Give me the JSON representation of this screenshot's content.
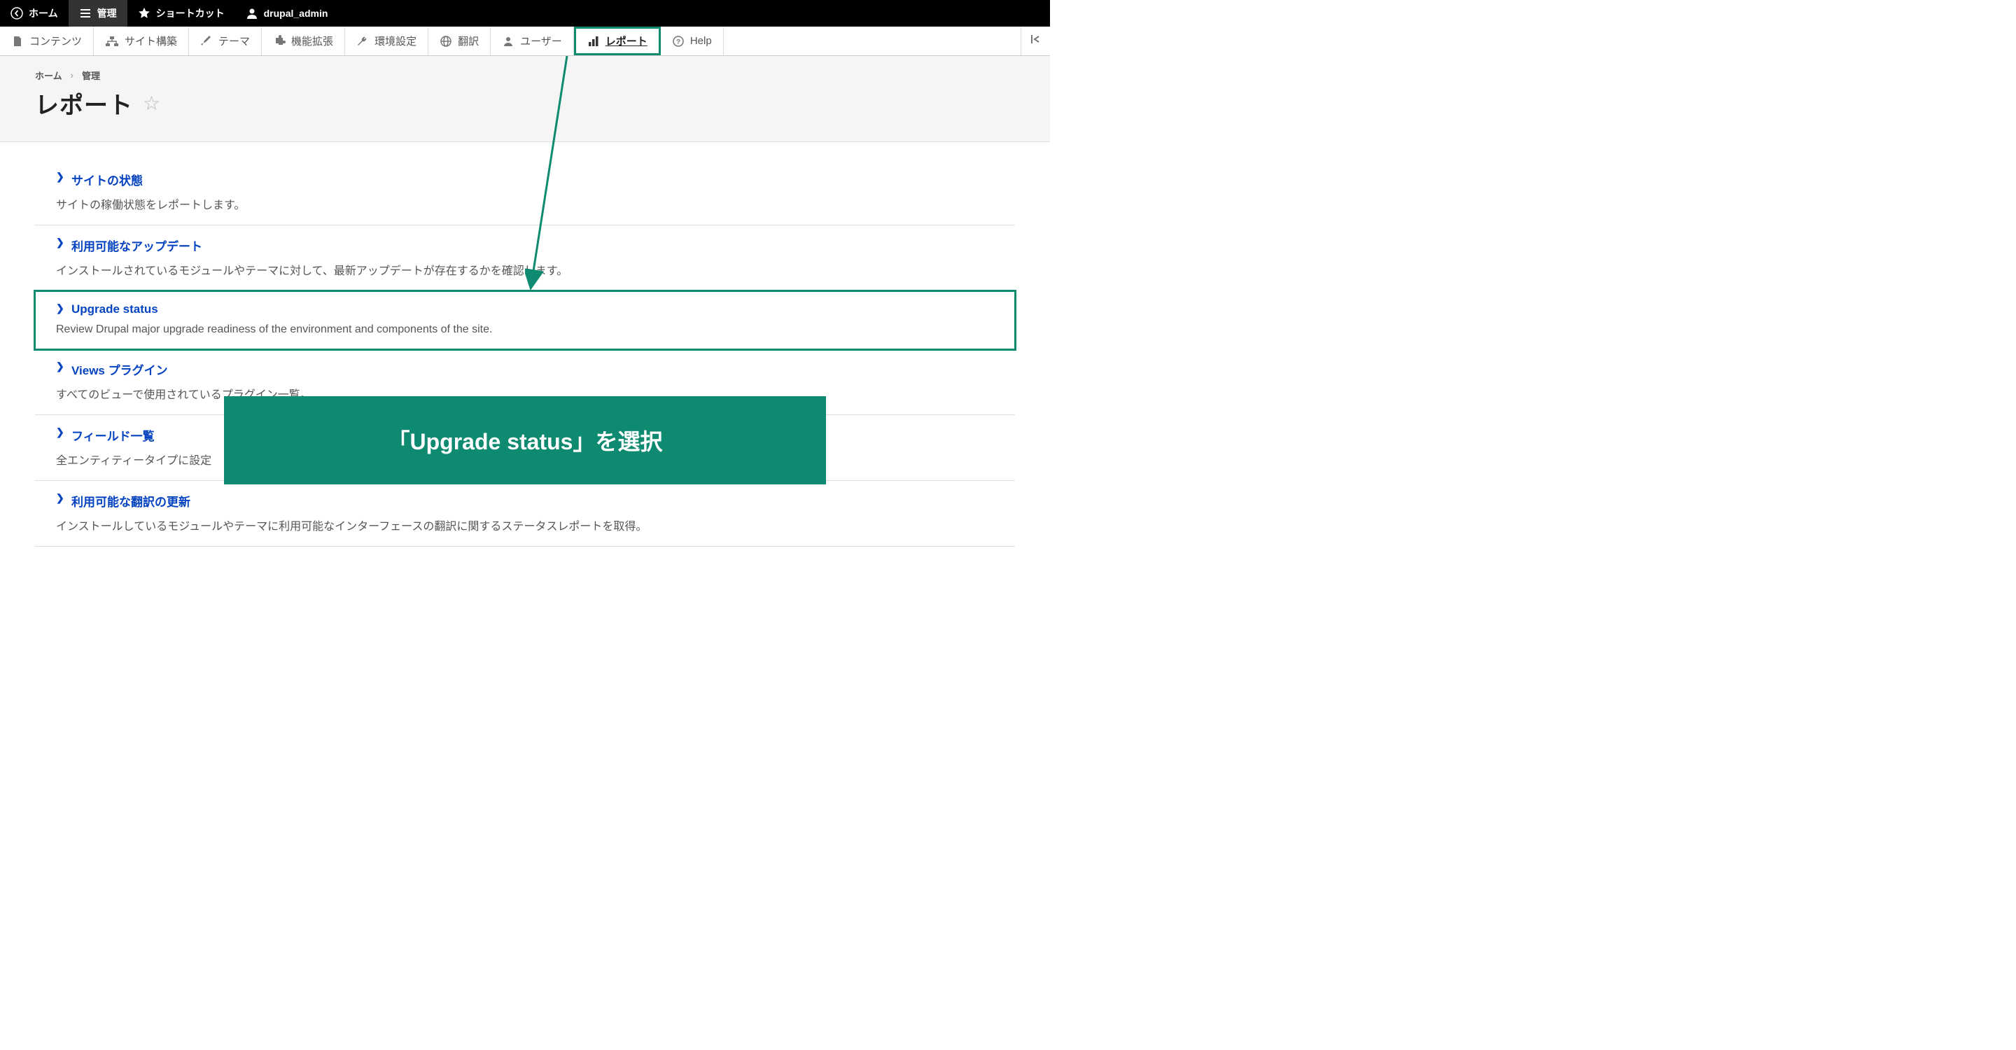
{
  "topbar": {
    "home": "ホーム",
    "admin": "管理",
    "shortcuts": "ショートカット",
    "user": "drupal_admin"
  },
  "secondbar": {
    "content": "コンテンツ",
    "structure": "サイト構築",
    "appearance": "テーマ",
    "extend": "機能拡張",
    "configuration": "環境設定",
    "translate": "翻訳",
    "people": "ユーザー",
    "reports": "レポート",
    "help": "Help"
  },
  "breadcrumb": {
    "home": "ホーム",
    "admin": "管理"
  },
  "page": {
    "title": "レポート"
  },
  "reports": [
    {
      "title": "サイトの状態",
      "desc": "サイトの稼働状態をレポートします。"
    },
    {
      "title": "利用可能なアップデート",
      "desc": "インストールされているモジュールやテーマに対して、最新アップデートが存在するかを確認します。"
    },
    {
      "title": "Upgrade status",
      "desc": "Review Drupal major upgrade readiness of the environment and components of the site."
    },
    {
      "title": "Views プラグイン",
      "desc": "すべてのビューで使用されているプラグイン一覧。"
    },
    {
      "title": "フィールド一覧",
      "desc": "全エンティティータイプに設定"
    },
    {
      "title": "利用可能な翻訳の更新",
      "desc": "インストールしているモジュールやテーマに利用可能なインターフェースの翻訳に関するステータスレポートを取得。"
    }
  ],
  "annotation": {
    "text": "「Upgrade status」を選択"
  }
}
